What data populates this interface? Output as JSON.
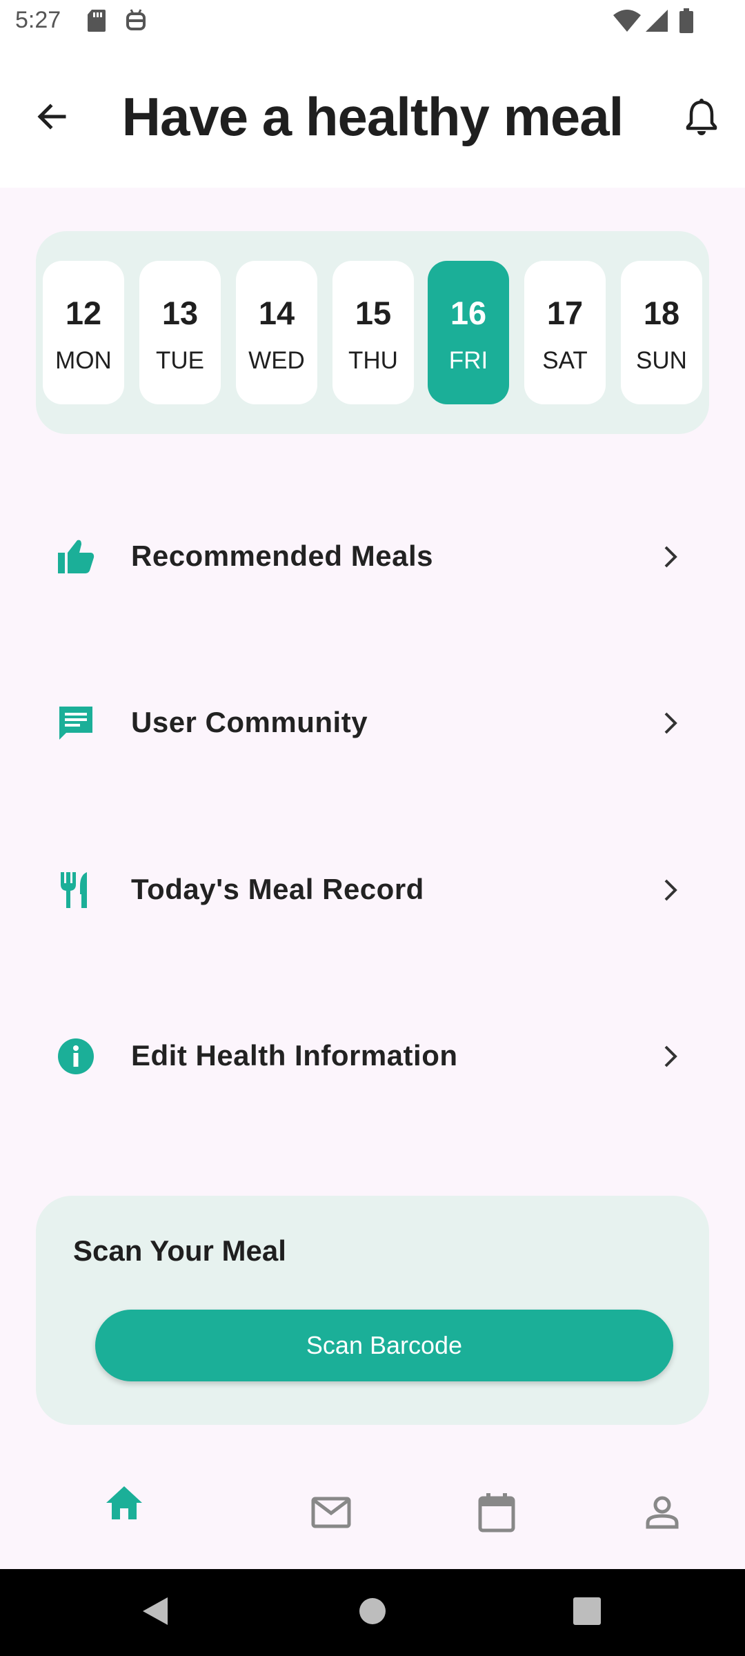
{
  "status_bar": {
    "time": "5:27",
    "icons": [
      "sd-card-icon",
      "android-debug-icon",
      "wifi-icon",
      "signal-icon",
      "battery-icon"
    ]
  },
  "header": {
    "title": "Have a healthy meal",
    "back_icon": "arrow-left-icon",
    "notification_icon": "bell-icon"
  },
  "dates": [
    {
      "num": "12",
      "day": "MON"
    },
    {
      "num": "13",
      "day": "TUE"
    },
    {
      "num": "14",
      "day": "WED"
    },
    {
      "num": "15",
      "day": "THU"
    },
    {
      "num": "16",
      "day": "FRI",
      "selected": true
    },
    {
      "num": "17",
      "day": "SAT"
    },
    {
      "num": "18",
      "day": "SUN"
    }
  ],
  "menu": [
    {
      "label": "Recommended Meals",
      "icon": "thumbs-up-icon"
    },
    {
      "label": "User Community",
      "icon": "chat-icon"
    },
    {
      "label": "Today's Meal Record",
      "icon": "fork-knife-icon"
    },
    {
      "label": "Edit Health Information",
      "icon": "info-icon"
    }
  ],
  "scan": {
    "title": "Scan Your Meal",
    "button_label": "Scan Barcode"
  },
  "bottom_nav": {
    "items": [
      "home-icon",
      "mail-icon",
      "calendar-icon",
      "person-icon"
    ],
    "active": "home-icon"
  },
  "colors": {
    "accent": "#1baf98",
    "card_bg": "#e7f2ef",
    "page_bg": "#fcf5fc",
    "inactive_icon": "#888888"
  }
}
